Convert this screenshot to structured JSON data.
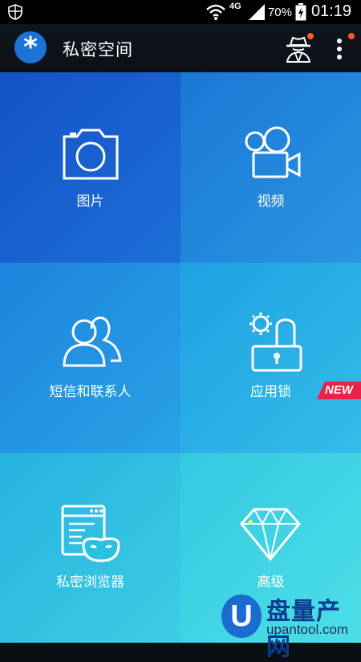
{
  "status_bar": {
    "network": "4G",
    "battery": "70%",
    "time": "01:19"
  },
  "app_bar": {
    "title": "私密空间",
    "menu_icon": "more-vert-icon",
    "incognito_icon": "spy-icon",
    "notification_color": "#ff5a1f"
  },
  "tiles": [
    {
      "label": "图片",
      "icon": "camera-icon"
    },
    {
      "label": "视频",
      "icon": "video-camera-icon"
    },
    {
      "label": "短信和联系人",
      "icon": "contacts-icon"
    },
    {
      "label": "应用锁",
      "icon": "app-lock-icon"
    },
    {
      "label": "私密浏览器",
      "icon": "private-browser-icon"
    },
    {
      "label": "高级",
      "icon": "diamond-icon"
    }
  ],
  "new_badge": "NEW",
  "watermark": {
    "letter": "U",
    "text": "盘量产网",
    "url": "upantool.com"
  },
  "colors": {
    "accent": "#1c73d6",
    "badge": "#e8234a"
  }
}
